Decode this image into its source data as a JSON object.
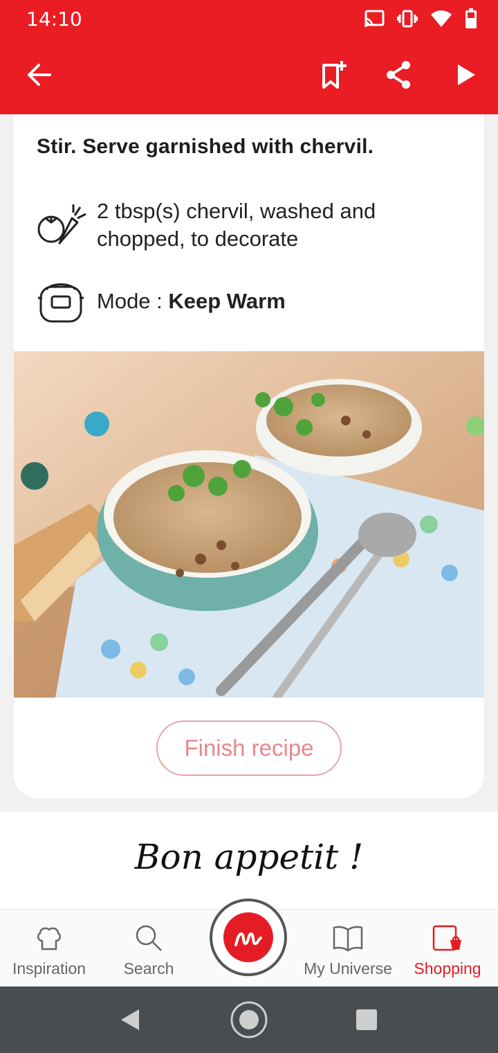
{
  "status_bar": {
    "time": "14:10",
    "icons": [
      "cast-icon",
      "vibrate-icon",
      "wifi-icon",
      "battery-icon"
    ]
  },
  "app_bar": {
    "icons": [
      "back-arrow-icon",
      "bookmark-add-icon",
      "share-icon",
      "play-icon"
    ]
  },
  "step": {
    "instruction": "Stir. Serve garnished with chervil.",
    "ingredient": {
      "icon": "vegetables-icon",
      "text": "2 tbsp(s) chervil, washed and chopped, to decorate"
    },
    "mode": {
      "icon": "cooker-icon",
      "label": "Mode : ",
      "value": "Keep Warm"
    }
  },
  "finish_button": "Finish recipe",
  "closing": "Bon appetit !",
  "bottom_nav": {
    "items": [
      {
        "label": "Inspiration",
        "icon": "chef-hat-icon"
      },
      {
        "label": "Search",
        "icon": "search-icon"
      },
      {
        "label": "My Universe",
        "icon": "book-icon"
      },
      {
        "label": "Shopping",
        "icon": "shopping-icon"
      }
    ],
    "active": "Shopping"
  },
  "colors": {
    "brand": "#ea1c24",
    "accent_soft": "#e8878b"
  }
}
